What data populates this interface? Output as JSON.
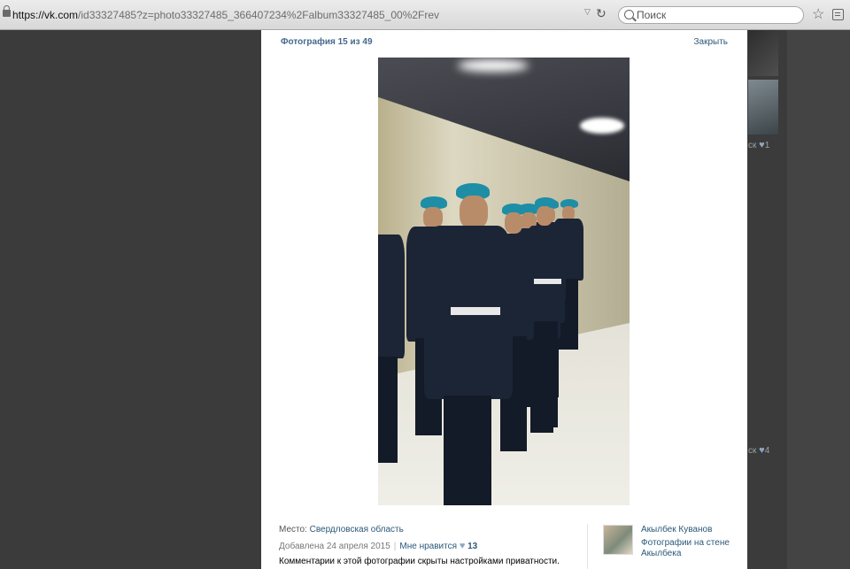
{
  "browser": {
    "url_host": "https://vk.com",
    "url_path": "/id33327485?z=photo33327485_366407234%2Falbum33327485_00%2Frev",
    "search_placeholder": "Поиск"
  },
  "viewer": {
    "counter": "Фотография 15 из 49",
    "close_label": "Закрыть",
    "place_label": "Место:",
    "place_value": "Свердловская область",
    "added_label": "Добавлена 24 апреля 2015",
    "like_label": "Мне нравится",
    "like_count": "13",
    "comments_notice": "Комментарии к этой фотографии скрыты настройками приватности.",
    "owner_name": "Акылбек Куванов",
    "owner_album": "Фотографии на стене Акылбека"
  },
  "background": {
    "like_count_1": "1",
    "like_count_2": "4"
  },
  "icons": [
    "lock-icon",
    "dropdown-icon",
    "reload-icon",
    "search-icon",
    "bookmark-star-icon",
    "reader-icon",
    "heart-icon"
  ],
  "colors": {
    "link": "#2b587a",
    "header": "#45688e",
    "beret": "#1d8ea6"
  }
}
